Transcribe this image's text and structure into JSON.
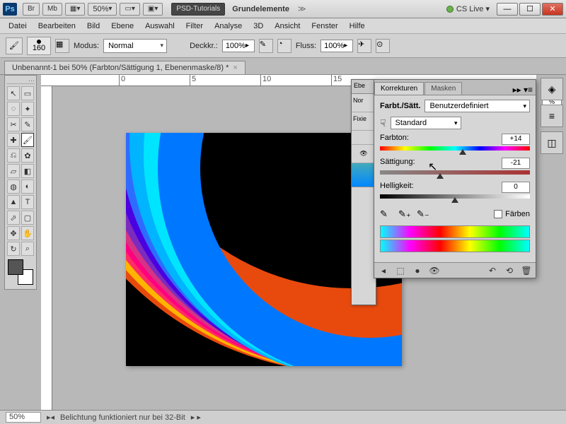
{
  "titlebar": {
    "ps": "Ps",
    "br": "Br",
    "mb": "Mb",
    "zoom": "50%",
    "workspace_btn": "PSD-Tutorials",
    "workspace2": "Grundelemente",
    "cslive": "CS Live"
  },
  "menu": [
    "Datei",
    "Bearbeiten",
    "Bild",
    "Ebene",
    "Auswahl",
    "Filter",
    "Analyse",
    "3D",
    "Ansicht",
    "Fenster",
    "Hilfe"
  ],
  "options": {
    "brush_size": "160",
    "modus_label": "Modus:",
    "modus_value": "Normal",
    "deckkr_label": "Deckkr.:",
    "deckkr_value": "100%",
    "fluss_label": "Fluss:",
    "fluss_value": "100%"
  },
  "doctab": {
    "title": "Unbenannt-1 bei 50% (Farbton/Sättigung 1, Ebenenmaske/8) *"
  },
  "ruler_ticks": [
    "0",
    "5",
    "10",
    "15"
  ],
  "behind_panel": {
    "t1": "Ebe",
    "t2": "Nor",
    "t3": "Fixie"
  },
  "panel": {
    "tab_korrekturen": "Korrekturen",
    "tab_masken": "Masken",
    "title": "Farbt./Sätt.",
    "preset": "Benutzerdefiniert",
    "scope": "Standard",
    "farbton_label": "Farbton:",
    "farbton_value": "+14",
    "saettigung_label": "Sättigung:",
    "saettigung_value": "-21",
    "helligkeit_label": "Helligkeit:",
    "helligkeit_value": "0",
    "faerben_label": "Färben"
  },
  "right_pct": "%",
  "status": {
    "zoom": "50%",
    "msg": "Belichtung funktioniert nur bei 32-Bit"
  },
  "tools": [
    [
      "↖",
      "▭"
    ],
    [
      "◌",
      "✦"
    ],
    [
      "✂",
      "✎"
    ],
    [
      "✚",
      "⌖"
    ],
    [
      "✿",
      "✔"
    ],
    [
      "⎌",
      "◧"
    ],
    [
      "◍",
      "◐"
    ],
    [
      "▲",
      "T"
    ],
    [
      "⬀",
      "▢"
    ],
    [
      "✥",
      "⌕"
    ],
    [
      "☰",
      "⋯"
    ]
  ]
}
